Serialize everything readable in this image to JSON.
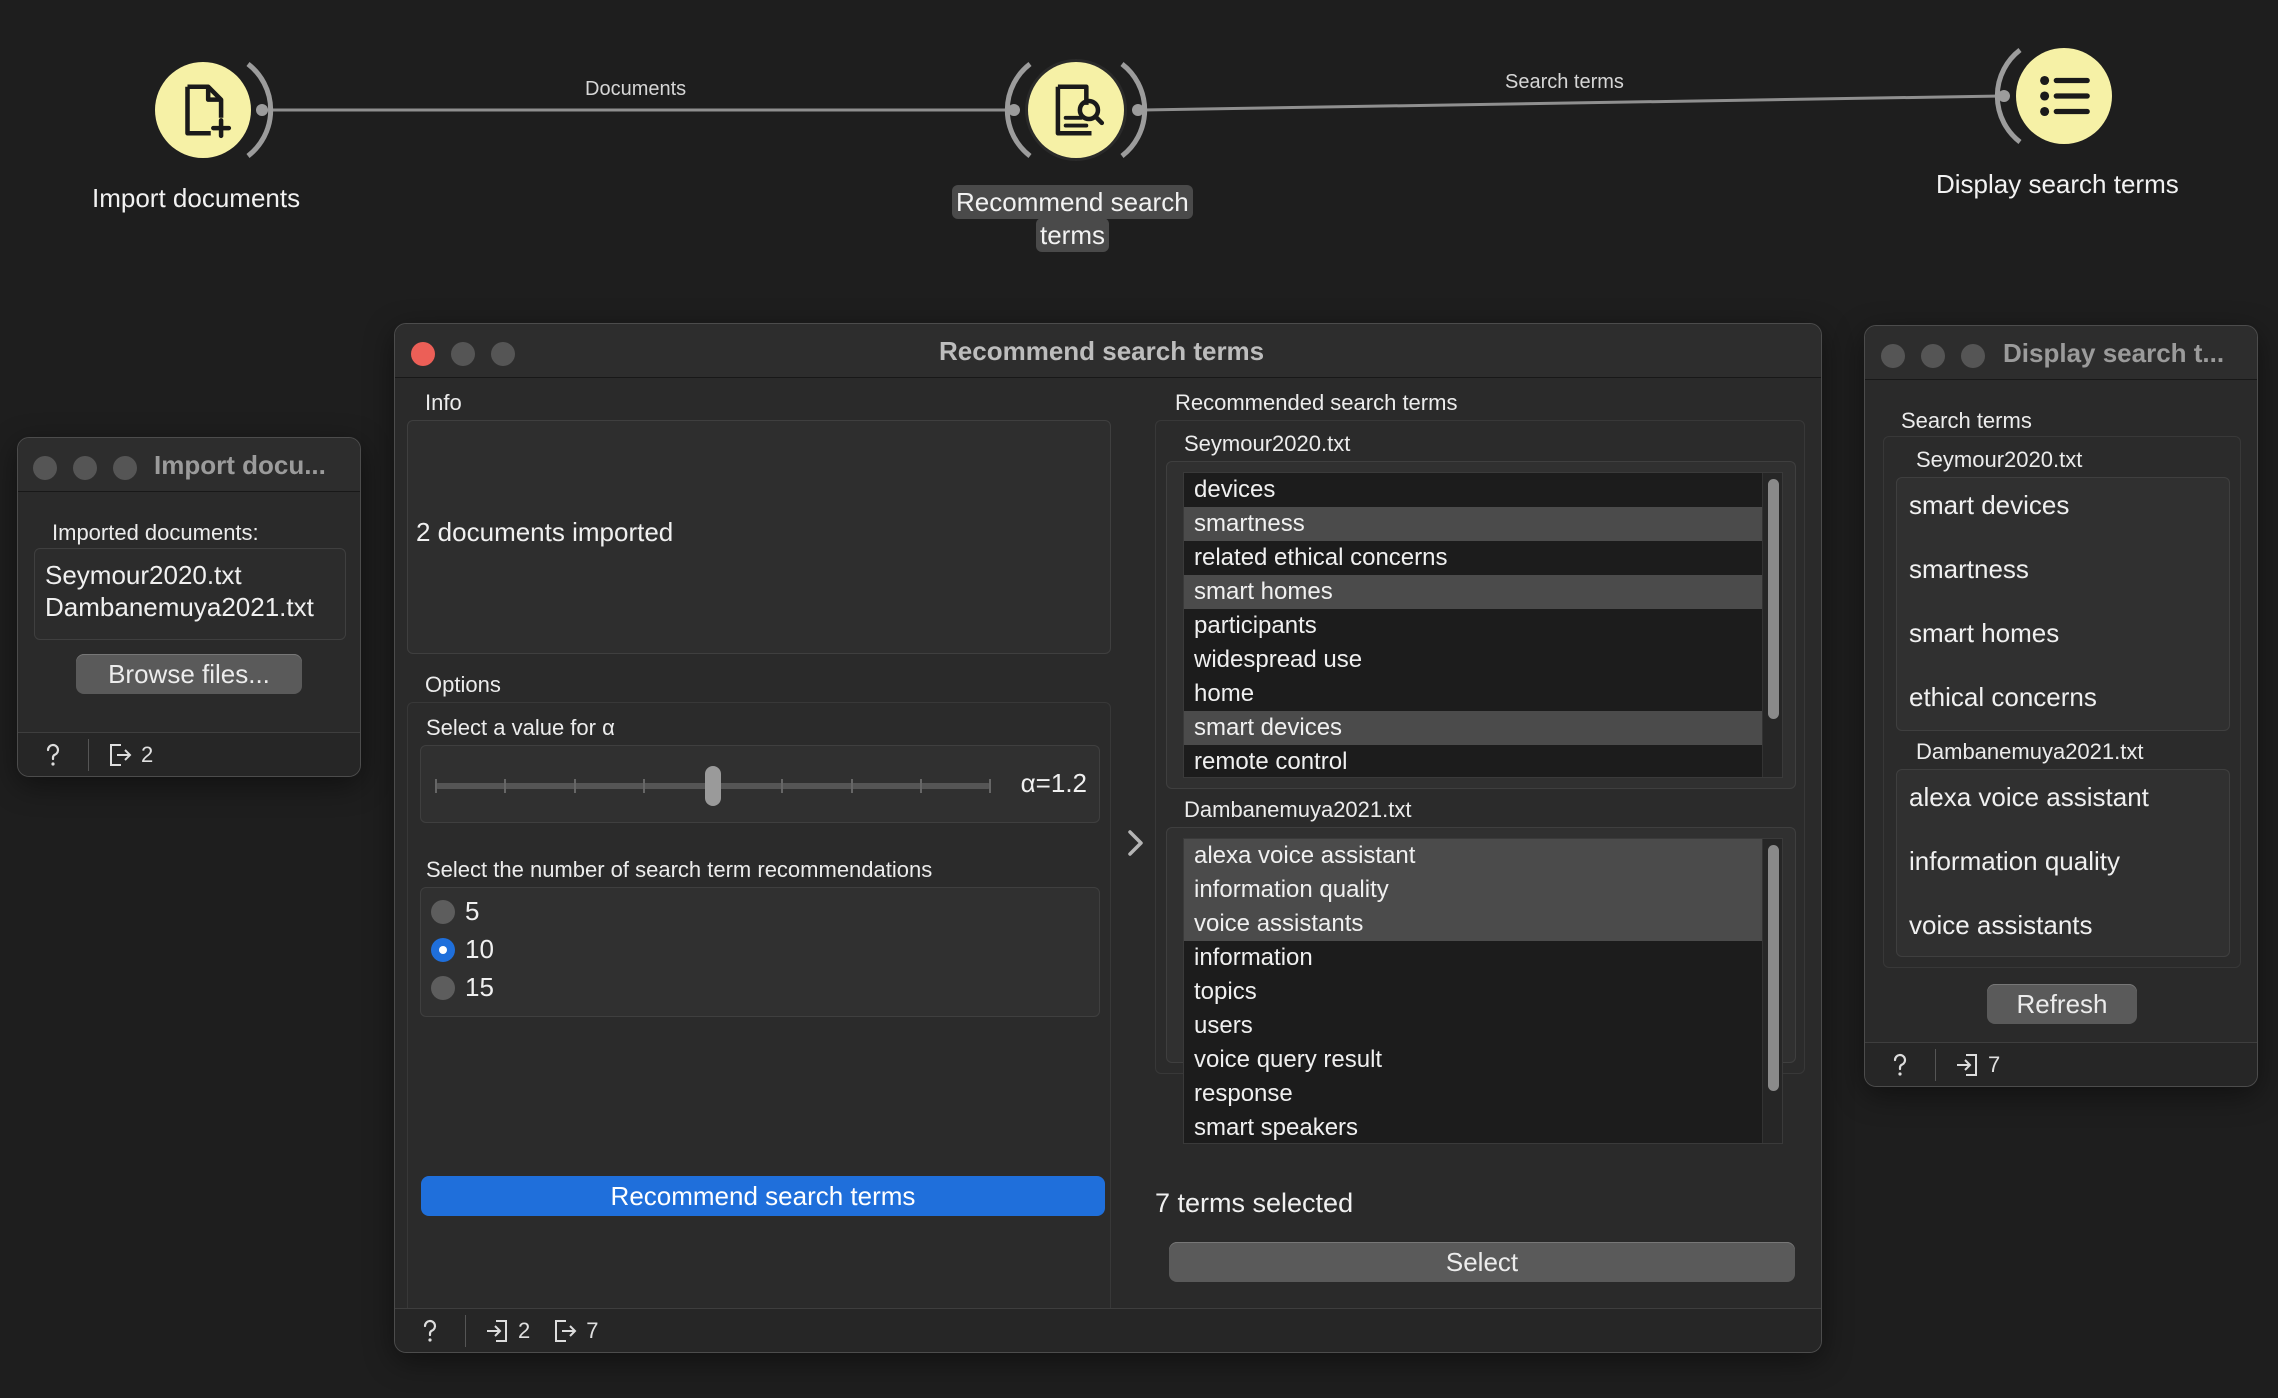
{
  "workflow": {
    "nodes": [
      {
        "label": "Import documents",
        "icon": "document-add-icon"
      },
      {
        "label_line1": "Recommend search",
        "label_line2": "terms",
        "icon": "document-search-icon"
      },
      {
        "label": "Display search terms",
        "icon": "list-icon"
      }
    ],
    "links": [
      "Documents",
      "Search terms"
    ]
  },
  "import_window": {
    "title": "Import docu...",
    "imported_label": "Imported documents:",
    "files": [
      "Seymour2020.txt",
      "Dambanemuya2021.txt"
    ],
    "browse_button": "Browse files...",
    "output_count": "2"
  },
  "recommend_window": {
    "title": "Recommend search terms",
    "info_label": "Info",
    "info_text": "2 documents imported",
    "options_label": "Options",
    "alpha_label": "Select a value for α",
    "alpha_value_text": "α=1.2",
    "alpha_fraction": 0.5,
    "count_label": "Select the number of search term recommendations",
    "count_options": [
      "5",
      "10",
      "15"
    ],
    "count_selected": "10",
    "recommend_button": "Recommend search terms",
    "recommended_label": "Recommended search terms",
    "doc1": {
      "name": "Seymour2020.txt",
      "terms": [
        "devices",
        "smartness",
        "related ethical concerns",
        "smart homes",
        "participants",
        "widespread use",
        "home",
        "smart devices",
        "remote control"
      ],
      "selected": [
        false,
        true,
        false,
        true,
        false,
        false,
        false,
        true,
        false
      ]
    },
    "doc2": {
      "name": "Dambanemuya2021.txt",
      "terms": [
        "alexa voice assistant",
        "information quality",
        "voice assistants",
        "information",
        "topics",
        "users",
        "voice query result",
        "response",
        "smart speakers"
      ],
      "selected": [
        true,
        true,
        true,
        false,
        false,
        false,
        false,
        false,
        false
      ]
    },
    "selection_status": "7 terms selected",
    "select_button": "Select",
    "input_count": "2",
    "output_count": "7"
  },
  "display_window": {
    "title": "Display search t...",
    "section_label": "Search terms",
    "doc1": {
      "name": "Seymour2020.txt",
      "terms": [
        "smart devices",
        "smartness",
        "smart homes",
        "ethical concerns"
      ]
    },
    "doc2": {
      "name": "Dambanemuya2021.txt",
      "terms": [
        "alexa voice assistant",
        "information quality",
        "voice assistants"
      ]
    },
    "refresh_button": "Refresh",
    "input_count": "7"
  }
}
